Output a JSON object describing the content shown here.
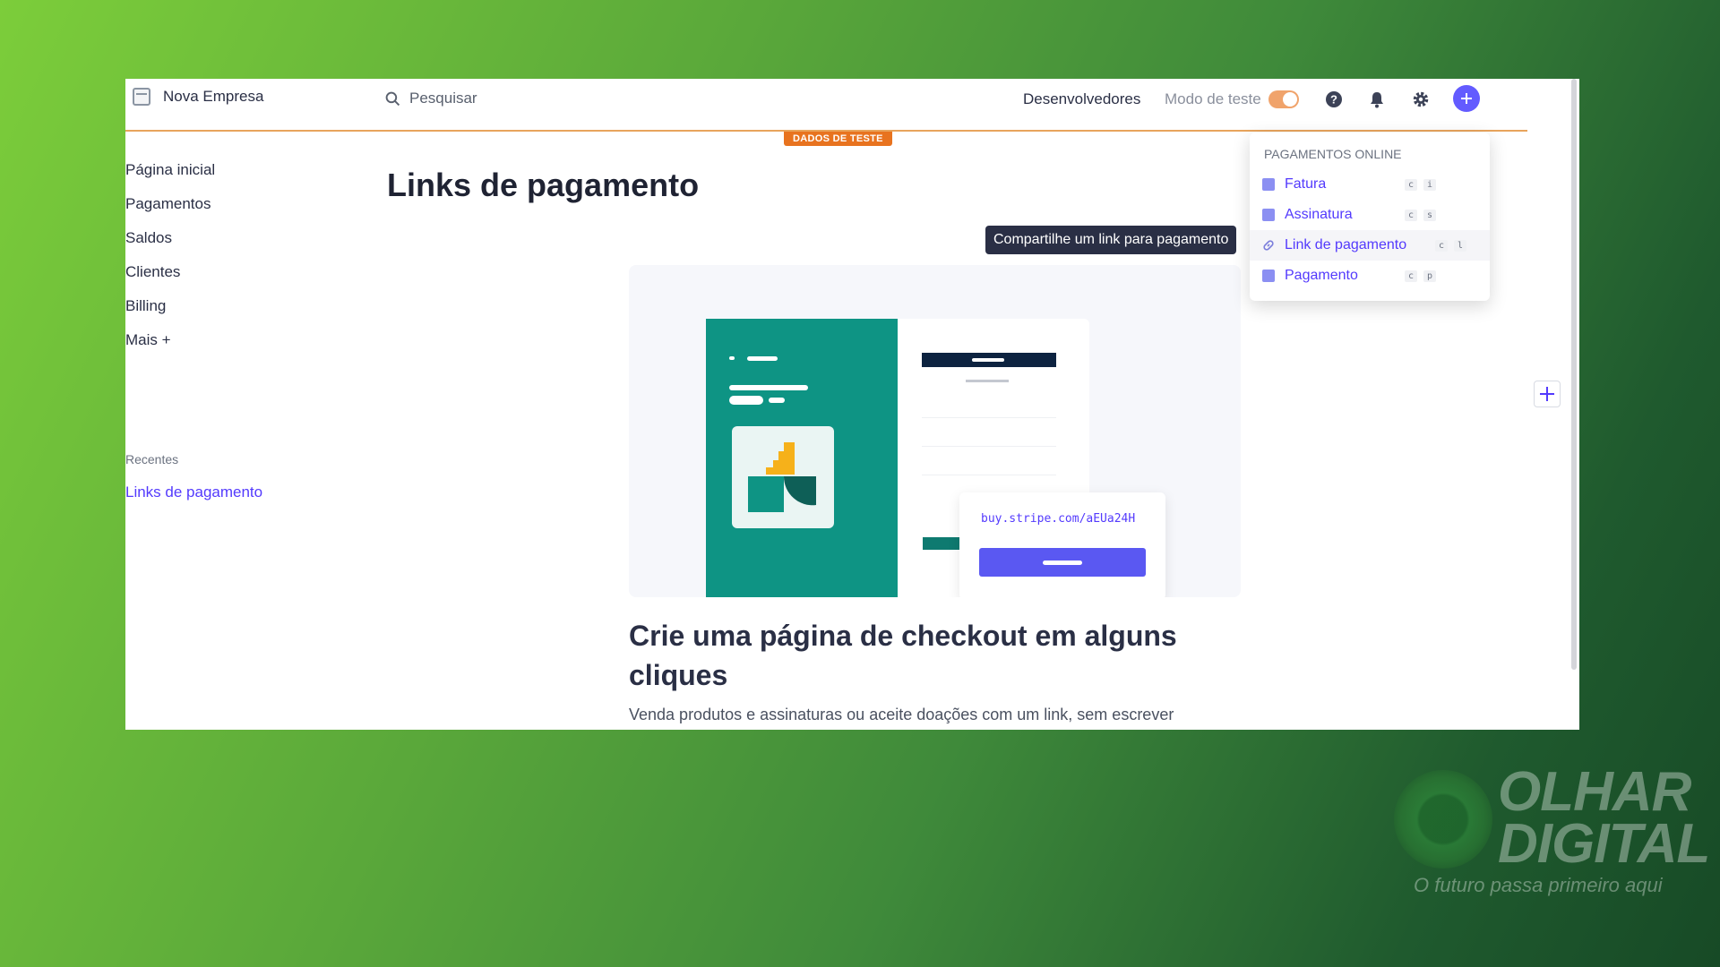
{
  "topbar": {
    "brand": "Nova Empresa",
    "search_placeholder": "Pesquisar",
    "developers": "Desenvolvedores",
    "test_mode_label": "Modo de teste",
    "test_mode_on": true
  },
  "test_badge": "DADOS DE TESTE",
  "sidebar": {
    "items": [
      {
        "label": "Página inicial"
      },
      {
        "label": "Pagamentos"
      },
      {
        "label": "Saldos"
      },
      {
        "label": "Clientes"
      },
      {
        "label": "Billing"
      },
      {
        "label": "Mais +"
      }
    ],
    "recent_title": "Recentes",
    "recent_items": [
      {
        "label": "Links de pagamento"
      }
    ]
  },
  "main": {
    "title": "Links de pagamento",
    "tooltip": "Compartilhe um link para pagamento",
    "hero_url": "buy.stripe.com/aEUa24H",
    "hero_heading": "Crie uma página de checkout em alguns cliques",
    "hero_desc": "Venda produtos e assinaturas ou aceite doações com um link, sem escrever"
  },
  "dropdown": {
    "title": "PAGAMENTOS ONLINE",
    "items": [
      {
        "label": "Fatura",
        "keys": [
          "c",
          "i"
        ]
      },
      {
        "label": "Assinatura",
        "keys": [
          "c",
          "s"
        ]
      },
      {
        "label": "Link de pagamento",
        "keys": [
          "c",
          "l"
        ]
      },
      {
        "label": "Pagamento",
        "keys": [
          "c",
          "p"
        ]
      }
    ]
  },
  "watermark": {
    "title_line1": "OLHAR",
    "title_line2": "DIGITAL",
    "tagline": "O futuro passa primeiro aqui"
  },
  "colors": {
    "accent": "#533afd",
    "test_orange": "#e8731f",
    "teal": "#0e9484"
  }
}
